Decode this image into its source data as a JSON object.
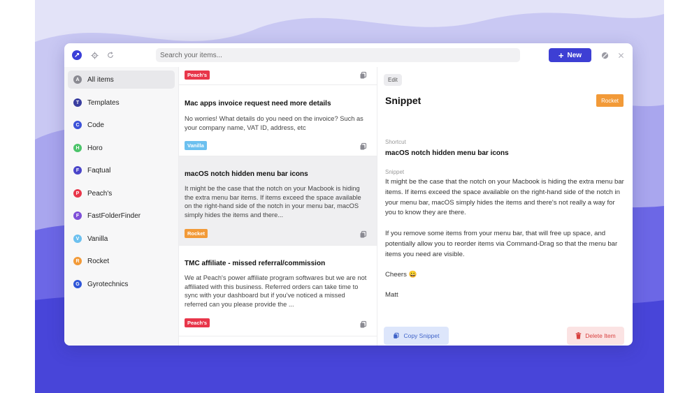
{
  "colors": {
    "accent": "#3d3fd4",
    "tag_peachs": "#e8364a",
    "tag_vanilla": "#6cc0ef",
    "tag_rocket": "#f29a38"
  },
  "header": {
    "search_placeholder": "Search your items...",
    "new_label": "New"
  },
  "sidebar": {
    "items": [
      {
        "letter": "A",
        "label": "All items",
        "color": "#8a8a92"
      },
      {
        "letter": "T",
        "label": "Templates",
        "color": "#3a3ea0"
      },
      {
        "letter": "C",
        "label": "Code",
        "color": "#3c52d8"
      },
      {
        "letter": "H",
        "label": "Horo",
        "color": "#4cc46a"
      },
      {
        "letter": "F",
        "label": "Faqtual",
        "color": "#4a45c9"
      },
      {
        "letter": "P",
        "label": "Peach's",
        "color": "#e8364a"
      },
      {
        "letter": "F",
        "label": "FastFolderFinder",
        "color": "#7e4fd8"
      },
      {
        "letter": "V",
        "label": "Vanilla",
        "color": "#6cc0ef"
      },
      {
        "letter": "R",
        "label": "Rocket",
        "color": "#f29a38"
      },
      {
        "letter": "G",
        "label": "Gyrotechnics",
        "color": "#2f56d8"
      }
    ]
  },
  "list": {
    "cards": [
      {
        "title": "",
        "body": "",
        "tag": "Peach's"
      },
      {
        "title": "Mac apps invoice request need more details",
        "body": "No worries! What details do you need on the invoice? Such as your company name, VAT ID, address, etc",
        "tag": "Vanilla"
      },
      {
        "title": "macOS notch hidden menu bar icons",
        "body": "It might be the case that the notch on your Macbook is hiding the extra menu bar items. If items exceed the space available on the right-hand side of the notch in your menu bar, macOS simply hides the items and there...",
        "tag": "Rocket"
      },
      {
        "title": "TMC affiliate - missed referral/commission",
        "body": "We at Peach's power affiliate program softwares but we are not affiliated with this business. Referred orders can take time to sync with your dashboard but if you've noticed a missed referred can you please provide the ...",
        "tag": "Peach's"
      }
    ]
  },
  "detail": {
    "edit_label": "Edit",
    "title": "Snippet",
    "tag": "Rocket",
    "shortcut_caption": "Shortcut",
    "shortcut": "macOS notch hidden menu bar icons",
    "snippet_caption": "Snippet",
    "paragraph1": "It might be the case that the notch on your Macbook is hiding the extra menu bar items. If items exceed the space available on the right-hand side of the notch in your menu bar, macOS simply hides the items and there's not really a way for you to know they are there.",
    "paragraph2": "If you remove some items from your menu bar, that will free up space, and potentially allow you to reorder items via Command-Drag so that the menu bar items you need are visible.",
    "cheers": "Cheers 😀",
    "signature": "Matt",
    "copy_label": "Copy Snippet",
    "delete_label": "Delete Item"
  }
}
